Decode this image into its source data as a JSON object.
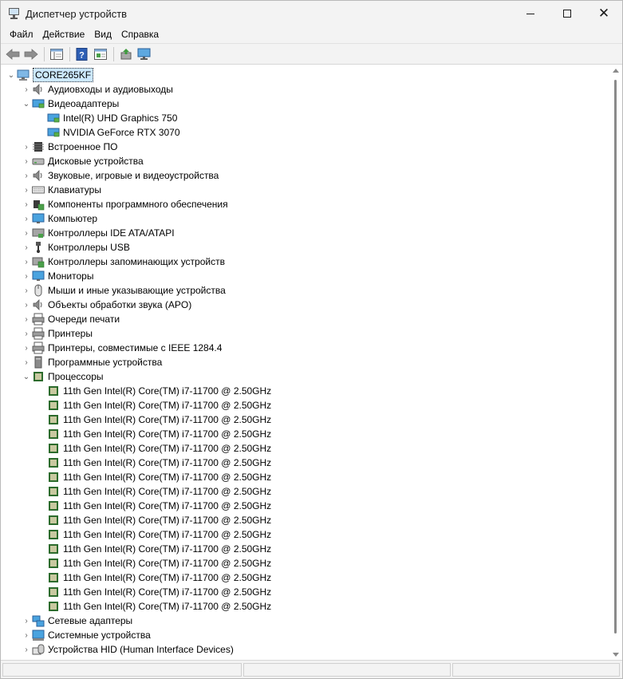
{
  "window": {
    "title": "Диспетчер устройств"
  },
  "menu": [
    "Файл",
    "Действие",
    "Вид",
    "Справка"
  ],
  "toolbar": [
    {
      "name": "back-button",
      "icon": "back-arrow-icon"
    },
    {
      "name": "forward-button",
      "icon": "forward-arrow-icon"
    },
    {
      "name": "show-hide-tree-button",
      "icon": "tree-view-icon"
    },
    {
      "name": "help-button",
      "icon": "help-icon"
    },
    {
      "name": "properties-button",
      "icon": "properties-icon"
    },
    {
      "name": "update-driver-button",
      "icon": "update-driver-icon"
    },
    {
      "name": "scan-hardware-button",
      "icon": "scan-hardware-icon"
    }
  ],
  "tree": {
    "root": "CORE265KF",
    "items": [
      {
        "label": "Аудиовходы и аудиовыходы",
        "icon": "speaker",
        "expanded": false
      },
      {
        "label": "Видеоадаптеры",
        "icon": "display",
        "expanded": true,
        "children": [
          "Intel(R) UHD Graphics 750",
          "NVIDIA GeForce RTX 3070"
        ]
      },
      {
        "label": "Встроенное ПО",
        "icon": "chip",
        "expanded": false
      },
      {
        "label": "Дисковые устройства",
        "icon": "disk",
        "expanded": false
      },
      {
        "label": "Звуковые, игровые и видеоустройства",
        "icon": "speaker",
        "expanded": false
      },
      {
        "label": "Клавиатуры",
        "icon": "keyboard",
        "expanded": false
      },
      {
        "label": "Компоненты программного обеспечения",
        "icon": "component",
        "expanded": false
      },
      {
        "label": "Компьютер",
        "icon": "monitor",
        "expanded": false
      },
      {
        "label": "Контроллеры IDE ATA/ATAPI",
        "icon": "controller",
        "expanded": false
      },
      {
        "label": "Контроллеры USB",
        "icon": "usb",
        "expanded": false
      },
      {
        "label": "Контроллеры запоминающих устройств",
        "icon": "storage",
        "expanded": false
      },
      {
        "label": "Мониторы",
        "icon": "monitor",
        "expanded": false
      },
      {
        "label": "Мыши и иные указывающие устройства",
        "icon": "mouse",
        "expanded": false
      },
      {
        "label": "Объекты обработки звука (APO)",
        "icon": "speaker",
        "expanded": false
      },
      {
        "label": "Очереди печати",
        "icon": "printer",
        "expanded": false
      },
      {
        "label": "Принтеры",
        "icon": "printer",
        "expanded": false
      },
      {
        "label": "Принтеры, совместимые с IEEE 1284.4",
        "icon": "printer",
        "expanded": false
      },
      {
        "label": "Программные устройства",
        "icon": "software",
        "expanded": false
      },
      {
        "label": "Процессоры",
        "icon": "cpu",
        "expanded": true,
        "children": [
          "11th Gen Intel(R) Core(TM) i7-11700 @ 2.50GHz",
          "11th Gen Intel(R) Core(TM) i7-11700 @ 2.50GHz",
          "11th Gen Intel(R) Core(TM) i7-11700 @ 2.50GHz",
          "11th Gen Intel(R) Core(TM) i7-11700 @ 2.50GHz",
          "11th Gen Intel(R) Core(TM) i7-11700 @ 2.50GHz",
          "11th Gen Intel(R) Core(TM) i7-11700 @ 2.50GHz",
          "11th Gen Intel(R) Core(TM) i7-11700 @ 2.50GHz",
          "11th Gen Intel(R) Core(TM) i7-11700 @ 2.50GHz",
          "11th Gen Intel(R) Core(TM) i7-11700 @ 2.50GHz",
          "11th Gen Intel(R) Core(TM) i7-11700 @ 2.50GHz",
          "11th Gen Intel(R) Core(TM) i7-11700 @ 2.50GHz",
          "11th Gen Intel(R) Core(TM) i7-11700 @ 2.50GHz",
          "11th Gen Intel(R) Core(TM) i7-11700 @ 2.50GHz",
          "11th Gen Intel(R) Core(TM) i7-11700 @ 2.50GHz",
          "11th Gen Intel(R) Core(TM) i7-11700 @ 2.50GHz",
          "11th Gen Intel(R) Core(TM) i7-11700 @ 2.50GHz"
        ]
      },
      {
        "label": "Сетевые адаптеры",
        "icon": "network",
        "expanded": false
      },
      {
        "label": "Системные устройства",
        "icon": "system",
        "expanded": false
      },
      {
        "label": "Устройства HID (Human Interface Devices)",
        "icon": "hid",
        "expanded": false
      }
    ]
  },
  "colors": {
    "selection": "#cce8ff",
    "chrome": "#f3f3f3"
  }
}
